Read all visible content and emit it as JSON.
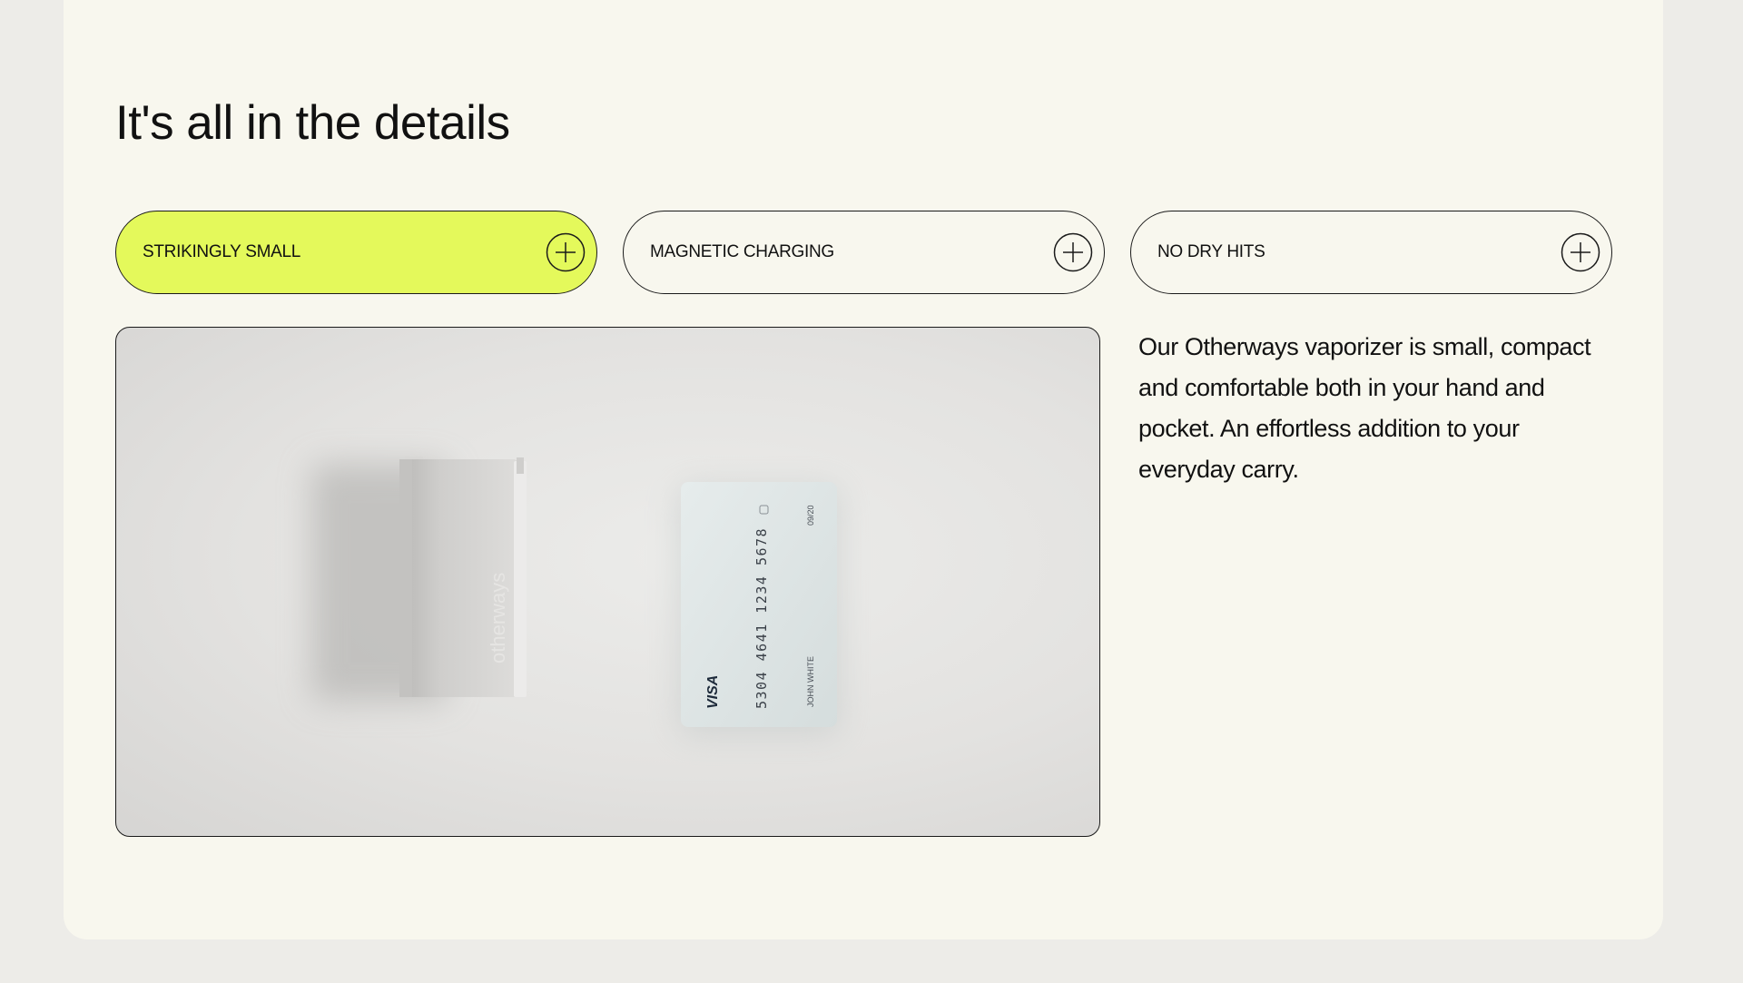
{
  "section": {
    "heading": "It's all in the details"
  },
  "tabs": [
    {
      "label": "STRIKINGLY SMALL",
      "active": true,
      "icon": "plus-icon"
    },
    {
      "label": "MAGNETIC CHARGING",
      "active": false,
      "icon": "plus-icon"
    },
    {
      "label": "NO DRY HITS",
      "active": false,
      "icon": "plus-icon"
    }
  ],
  "content": {
    "description": "Our Otherways vaporizer is small, compact and comfortable both in your hand and pocket. An effortless addition to your everyday carry.",
    "image": {
      "device_brand": "otherways",
      "card": {
        "brand": "VISA",
        "number": "5304 4641 1234 5678",
        "holder": "JOHN WHITE",
        "expiry": "09/20"
      }
    }
  },
  "colors": {
    "accent": "#e4f95b",
    "panel_background": "#f8f7ee",
    "page_background": "#edece8",
    "outline": "#1a1a1a"
  }
}
